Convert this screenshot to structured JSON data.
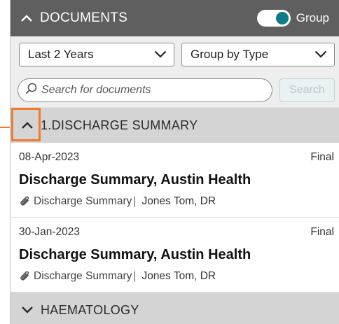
{
  "header": {
    "title": "DOCUMENTS",
    "toggle_label": "Group",
    "toggle_on": true,
    "accent_color": "#127a86"
  },
  "filters": {
    "period": "Last 2 Years",
    "grouping": "Group by Type"
  },
  "search": {
    "placeholder": "Search for documents",
    "button_label": "Search"
  },
  "groups": [
    {
      "label": "1.DISCHARGE SUMMARY",
      "expanded": true,
      "highlight_color": "#ee7c2c",
      "documents": [
        {
          "date": "08-Apr-2023",
          "status": "Final",
          "title": "Discharge Summary, Austin Health",
          "type": "Discharge Summary",
          "author": "Jones Tom, DR"
        },
        {
          "date": "30-Jan-2023",
          "status": "Final",
          "title": "Discharge Summary, Austin Health",
          "type": "Discharge Summary",
          "author": "Jones Tom, DR"
        }
      ]
    },
    {
      "label": "HAEMATOLOGY",
      "expanded": false
    }
  ]
}
